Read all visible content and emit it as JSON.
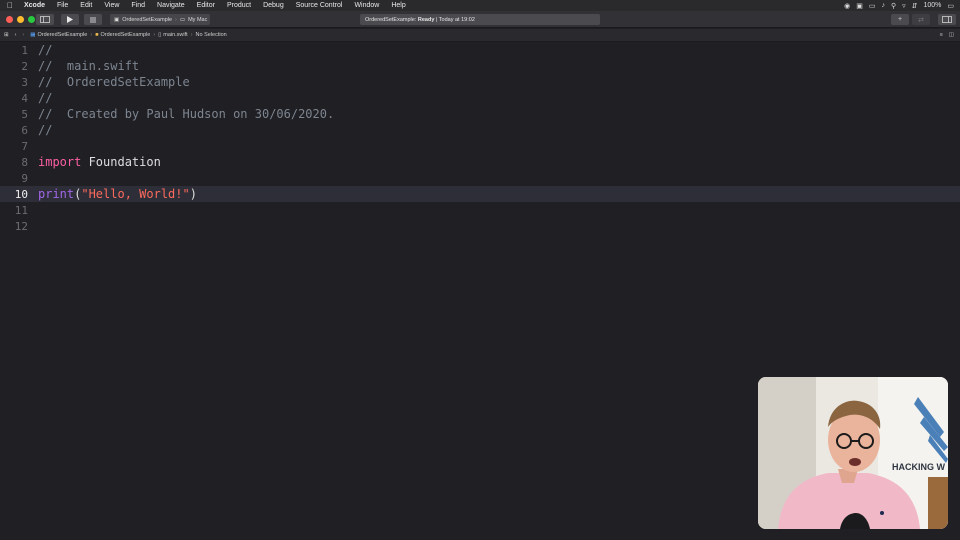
{
  "menubar": {
    "app_name": "Xcode",
    "items": [
      "File",
      "Edit",
      "View",
      "Find",
      "Navigate",
      "Editor",
      "Product",
      "Debug",
      "Source Control",
      "Window",
      "Help"
    ],
    "battery": "100%"
  },
  "toolbar": {
    "scheme": "OrderedSetExample",
    "destination": "My Mac",
    "activity_project": "OrderedSetExample:",
    "activity_status": "Ready",
    "activity_time": "| Today at 19:02"
  },
  "jumpbar": {
    "crumbs": [
      "OrderedSetExample",
      "OrderedSetExample",
      "main.swift",
      "No Selection"
    ]
  },
  "editor": {
    "current_line": 10,
    "lines": [
      {
        "n": "1",
        "comment": "//"
      },
      {
        "n": "2",
        "comment": "//  main.swift"
      },
      {
        "n": "3",
        "comment": "//  OrderedSetExample"
      },
      {
        "n": "4",
        "comment": "//"
      },
      {
        "n": "5",
        "comment": "//  Created by Paul Hudson on 30/06/2020."
      },
      {
        "n": "6",
        "comment": "//"
      },
      {
        "n": "7"
      },
      {
        "n": "8",
        "keyword": "import",
        "plain": " Foundation"
      },
      {
        "n": "9"
      },
      {
        "n": "10",
        "func": "print",
        "open": "(",
        "string": "\"Hello, World!\"",
        "close": ")"
      },
      {
        "n": "11"
      },
      {
        "n": "12"
      }
    ]
  },
  "webcam": {
    "wall_text": "HACKING W"
  },
  "colors": {
    "keyword": "#fc5fa3",
    "string": "#fc6a5d",
    "function": "#a167e6",
    "comment": "#7d8590",
    "current_line": "#2e2e38"
  }
}
